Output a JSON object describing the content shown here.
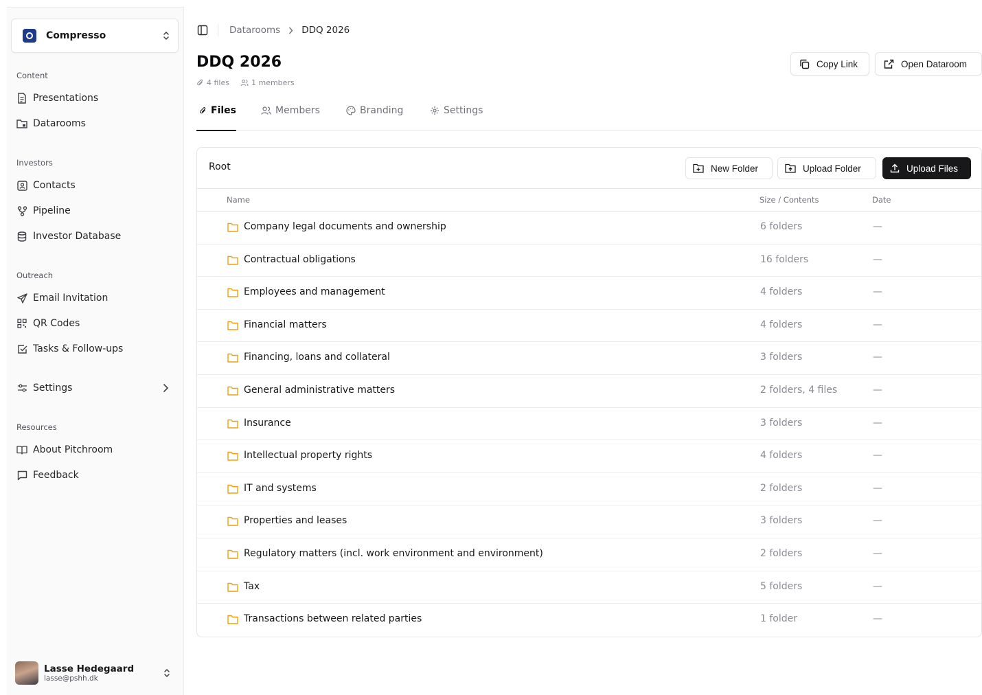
{
  "workspace": {
    "name": "Compresso"
  },
  "sidebar": {
    "sections": {
      "content": "Content",
      "investors": "Investors",
      "outreach": "Outreach",
      "resources": "Resources"
    },
    "items": {
      "presentations": "Presentations",
      "datarooms": "Datarooms",
      "contacts": "Contacts",
      "pipeline": "Pipeline",
      "investor_database": "Investor Database",
      "email_invitation": "Email Invitation",
      "qr_codes": "QR Codes",
      "tasks": "Tasks & Follow-ups",
      "settings": "Settings",
      "about": "About Pitchroom",
      "feedback": "Feedback"
    }
  },
  "user": {
    "name": "Lasse Hedegaard",
    "email": "lasse@pshh.dk"
  },
  "breadcrumb": {
    "parent": "Datarooms",
    "current": "DDQ 2026"
  },
  "page": {
    "title": "DDQ 2026",
    "files_count": "4 files",
    "members_count": "1 members"
  },
  "actions": {
    "copy_link": "Copy Link",
    "open_dataroom": "Open Dataroom"
  },
  "tabs": {
    "files": "Files",
    "members": "Members",
    "branding": "Branding",
    "settings": "Settings"
  },
  "card": {
    "root": "Root",
    "new_folder": "New Folder",
    "upload_folder": "Upload Folder",
    "upload_files": "Upload Files"
  },
  "table": {
    "headers": {
      "name": "Name",
      "size": "Size / Contents",
      "date": "Date"
    },
    "rows": [
      {
        "name": "Company legal documents and ownership",
        "size": "6 folders",
        "date": "—"
      },
      {
        "name": "Contractual obligations",
        "size": "16 folders",
        "date": "—"
      },
      {
        "name": "Employees and management",
        "size": "4 folders",
        "date": "—"
      },
      {
        "name": "Financial matters",
        "size": "4 folders",
        "date": "—"
      },
      {
        "name": "Financing, loans and collateral",
        "size": "3 folders",
        "date": "—"
      },
      {
        "name": "General administrative matters",
        "size": "2 folders, 4 files",
        "date": "—"
      },
      {
        "name": "Insurance",
        "size": "3 folders",
        "date": "—"
      },
      {
        "name": "Intellectual property rights",
        "size": "4 folders",
        "date": "—"
      },
      {
        "name": "IT and systems",
        "size": "2 folders",
        "date": "—"
      },
      {
        "name": "Properties and leases",
        "size": "3 folders",
        "date": "—"
      },
      {
        "name": "Regulatory matters (incl. work environment and environment)",
        "size": "2 folders",
        "date": "—"
      },
      {
        "name": "Tax",
        "size": "5 folders",
        "date": "—"
      },
      {
        "name": "Transactions between related parties",
        "size": "1 folder",
        "date": "—"
      }
    ]
  },
  "colors": {
    "folder": "#f59e0b",
    "primary": "#18181b",
    "muted": "#71717a"
  }
}
